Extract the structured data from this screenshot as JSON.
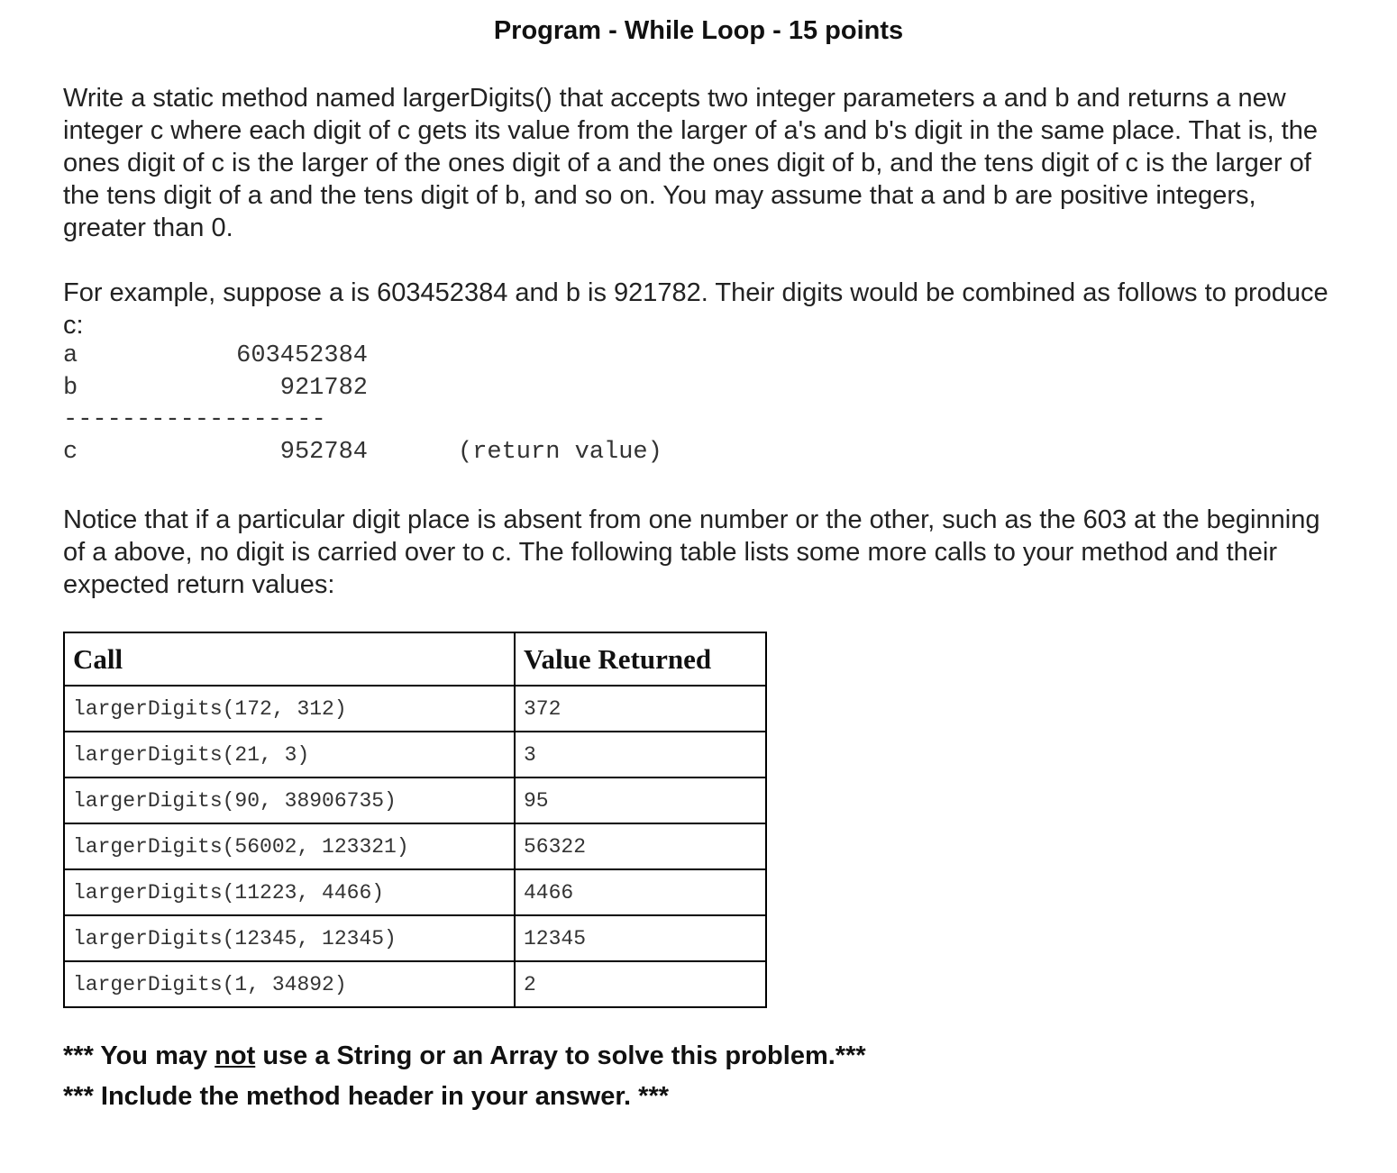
{
  "title": "Program - While Loop - 15 points",
  "paragraph1": "Write a static method named largerDigits() that accepts two integer parameters a and b and returns a new integer c where each digit of c gets its value from the larger of a's and b's digit in the same place. That is, the ones digit of c is the larger of the ones digit of a and the ones digit of b, and the tens digit of c is the larger of the tens digit of a and the tens digit of b, and so on. You may assume that a and b are positive integers, greater than 0.",
  "paragraph2": "For example, suppose a is 603452384 and b is 921782. Their digits would be combined as follows to produce c:",
  "example": {
    "a_label": "a",
    "a_value": "603452384",
    "b_label": "b",
    "b_value": "921782",
    "divider": "------------------",
    "c_label": "c",
    "c_value": "952784",
    "c_note": "(return value)"
  },
  "paragraph3": "Notice that if a particular digit place is absent from one number or the other, such as the 603 at the beginning of a above, no digit is carried over to c. The following table lists some more calls to your method and their expected return values:",
  "table": {
    "headers": [
      "Call",
      "Value Returned"
    ],
    "rows": [
      [
        "largerDigits(172, 312)",
        "372"
      ],
      [
        "largerDigits(21, 3)",
        "3"
      ],
      [
        "largerDigits(90, 38906735)",
        "95"
      ],
      [
        "largerDigits(56002, 123321)",
        "56322"
      ],
      [
        "largerDigits(11223, 4466)",
        "4466"
      ],
      [
        "largerDigits(12345, 12345)",
        "12345"
      ],
      [
        "largerDigits(1, 34892)",
        "2"
      ]
    ]
  },
  "note1": {
    "before": "*** You may ",
    "underlined": "not",
    "after": " use a String or an Array to solve this problem.***"
  },
  "note2": "*** Include the method header in your answer. ***"
}
